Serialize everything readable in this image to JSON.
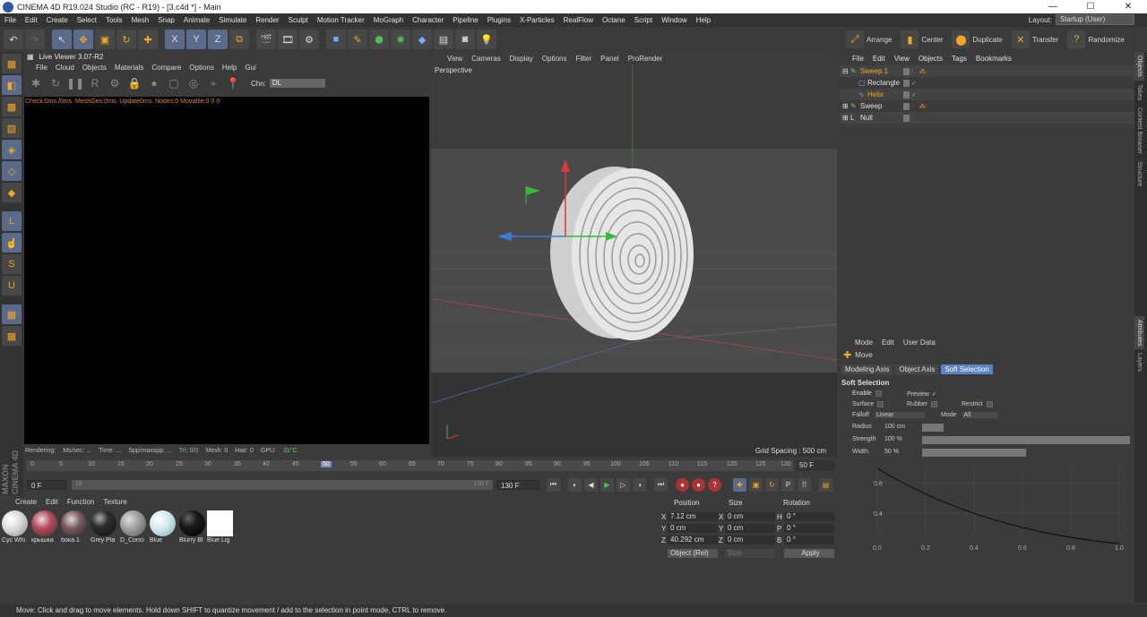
{
  "window": {
    "title": "CINEMA 4D R19.024 Studio (RC - R19) - [3.c4d *] - Main"
  },
  "menubar": [
    "File",
    "Edit",
    "Create",
    "Select",
    "Tools",
    "Mesh",
    "Snap",
    "Animate",
    "Simulate",
    "Render",
    "Sculpt",
    "Motion Tracker",
    "MoGraph",
    "Character",
    "Pipeline",
    "Plugins",
    "X-Particles",
    "RealFlow",
    "Octane",
    "Script",
    "Window",
    "Help"
  ],
  "layout": {
    "label": "Layout:",
    "value": "Startup (User)"
  },
  "toolbar": {
    "axis_x": "X",
    "axis_y": "Y",
    "axis_z": "Z"
  },
  "rtools": [
    {
      "label": "Arrange"
    },
    {
      "label": "Center"
    },
    {
      "label": "Duplicate"
    },
    {
      "label": "Transfer"
    },
    {
      "label": "Randomize"
    }
  ],
  "live_viewer": {
    "title": "Live Viewer 3.07-R2",
    "menu": [
      "File",
      "Cloud",
      "Objects",
      "Materials",
      "Compare",
      "Options",
      "Help",
      "Gui"
    ],
    "chn_label": "Chn:",
    "chn_value": "DL",
    "status": "Check:0ms./0ms. MeshGen:0ms. Update0ms. Nodes:0 Movable:0  0 0",
    "bottom": {
      "rendering": "Rendering:",
      "ms_sec": "Ms/sec: ...",
      "time": "Time: ...",
      "spp": "Spp/maxspp: ...",
      "tri": "Tri: 0/0",
      "mesh": "Mesh: 0",
      "hair": "Hair: 0",
      "gpu": "GPU:",
      "gpu_temp": "31°C"
    }
  },
  "viewport": {
    "menu": [
      "View",
      "Cameras",
      "Display",
      "Options",
      "Filter",
      "Panel",
      "ProRender"
    ],
    "label": "Perspective",
    "grid_spacing": "Grid Spacing : 500 cm"
  },
  "object_manager": {
    "menu": [
      "File",
      "Edit",
      "View",
      "Objects",
      "Tags",
      "Bookmarks"
    ],
    "objects": [
      {
        "name": "Sweep.1",
        "color": "#f5a623"
      },
      {
        "name": "Rectangle",
        "color": "#e0e0e0"
      },
      {
        "name": "Helix",
        "color": "#f5a623"
      },
      {
        "name": "Sweep",
        "color": "#e0e0e0"
      },
      {
        "name": "Null",
        "color": "#e0e0e0"
      }
    ]
  },
  "right_tabs": [
    "Objects",
    "Takes",
    "Content Browser",
    "Structure",
    "Attributes",
    "Layers"
  ],
  "attributes": {
    "menu": [
      "Mode",
      "Edit",
      "User Data"
    ],
    "tool_name": "Move",
    "tabs": [
      "Modeling Axis",
      "Object Axis",
      "Soft Selection"
    ],
    "active_tab": "Soft Selection",
    "section": "Soft Selection",
    "fields": {
      "enable": "Enable",
      "preview": "Preview",
      "preview_check": "✓",
      "surface": "Surface",
      "rubber": "Rubber",
      "restrict": "Restrict",
      "falloff": "Falloff",
      "falloff_value": "Linear",
      "mode": "Mode",
      "mode_value": "All",
      "radius": "Radius",
      "radius_value": "100 cm",
      "strength": "Strength",
      "strength_value": "100 %",
      "width": "Width.",
      "width_value": "50 %"
    },
    "graph": {
      "y_ticks": [
        "0.8",
        "0.4"
      ],
      "x_ticks": [
        "0.0",
        "0.2",
        "0.4",
        "0.6",
        "0.8",
        "1.0"
      ]
    }
  },
  "timeline": {
    "ticks": [
      "0",
      "5",
      "10",
      "15",
      "20",
      "25",
      "30",
      "35",
      "40",
      "45",
      "50",
      "55",
      "60",
      "65",
      "70",
      "75",
      "80",
      "85",
      "90",
      "95",
      "100",
      "105",
      "110",
      "115",
      "120",
      "125",
      "130"
    ],
    "end_frame": "50 F",
    "current": "0 F",
    "range_start": "0 F",
    "range_end": "130 F",
    "slider_end": "130 F",
    "slider_start": "18"
  },
  "materials": {
    "menu": [
      "Create",
      "Edit",
      "Function",
      "Texture"
    ],
    "items": [
      {
        "name": "Cyc Whi",
        "color": "#d8d8d8"
      },
      {
        "name": "крышка",
        "color": "#b74b5a"
      },
      {
        "name": "бока.1",
        "color": "#7a5a60"
      },
      {
        "name": "Grey Pla",
        "color": "#2e2e2e"
      },
      {
        "name": "D_Conci",
        "color": "#9a9a9a"
      },
      {
        "name": "Blue",
        "color": "#cfe8ee"
      },
      {
        "name": "Blurry Bl",
        "color": "#1a1a1a"
      },
      {
        "name": "Blue Lig",
        "color": "#ffffff"
      }
    ]
  },
  "coordinates": {
    "headers": [
      "Position",
      "Size",
      "Rotation"
    ],
    "rows": [
      {
        "axis": "X",
        "pos": "7.12 cm",
        "size": "0 cm",
        "rot_label": "H",
        "rot": "0 °"
      },
      {
        "axis": "Y",
        "pos": "0 cm",
        "size": "0 cm",
        "rot_label": "P",
        "rot": "0 °"
      },
      {
        "axis": "Z",
        "pos": "40.292 cm",
        "size": "0 cm",
        "rot_label": "B",
        "rot": "0 °"
      }
    ],
    "mode": "Object (Rel)",
    "size_mode": "Size",
    "apply": "Apply"
  },
  "status": "Move: Click and drag to move elements. Hold down SHIFT to quantize movement / add to the selection in point mode, CTRL to remove."
}
